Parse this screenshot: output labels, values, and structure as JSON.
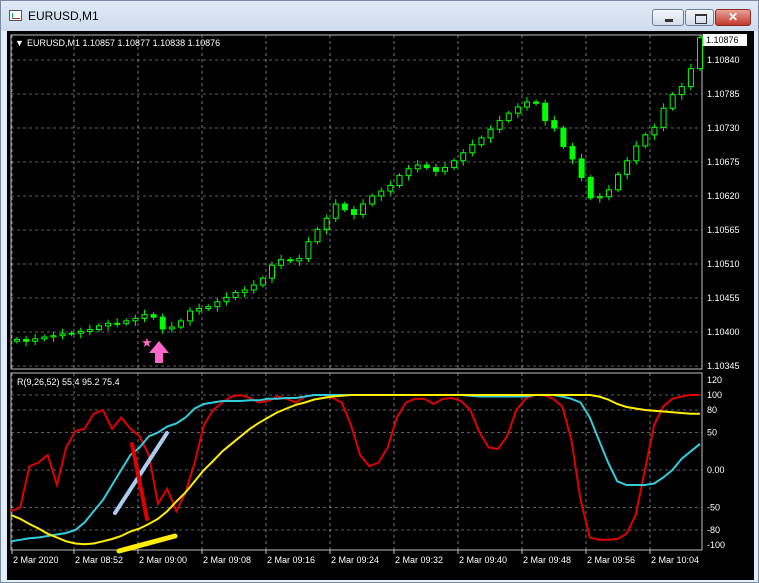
{
  "window": {
    "title": "EURUSD,M1"
  },
  "main_chart": {
    "info_line": "EURUSD,M1  1.10857 1.10877 1.10838 1.10876",
    "current_price": "1.10876",
    "price_axis": [
      "1.10840",
      "1.10785",
      "1.10730",
      "1.10675",
      "1.10620",
      "1.10565",
      "1.10510",
      "1.10455",
      "1.10400",
      "1.10345"
    ]
  },
  "indicator": {
    "label": "R(9,26,52) 55.4 95.2 75.4",
    "axis": [
      "120",
      "100",
      "80",
      "50",
      "0.00",
      "-50",
      "-80",
      "-100"
    ]
  },
  "time_axis": [
    "2 Mar 2020",
    "2 Mar 08:52",
    "2 Mar 09:00",
    "2 Mar 09:08",
    "2 Mar 09:16",
    "2 Mar 09:24",
    "2 Mar 09:32",
    "2 Mar 09:40",
    "2 Mar 09:48",
    "2 Mar 09:56",
    "2 Mar 10:04"
  ],
  "colors": {
    "background": "#000000",
    "candles": "#00ff00",
    "grid": "#c0c0c0",
    "fast_line": "#e00000",
    "mid_line": "#33ccdd",
    "slow_line": "#ffee00",
    "annotation_pink": "#ff66cc"
  },
  "chart_data": [
    {
      "type": "candlestick",
      "symbol": "EURUSD",
      "timeframe": "M1",
      "x_range": [
        "2 Mar 2020 08:44",
        "2 Mar 2020 10:10"
      ],
      "y_range": [
        1.10345,
        1.10876
      ],
      "last_ohlc": {
        "open": 1.10857,
        "high": 1.10877,
        "low": 1.10838,
        "close": 1.10876
      },
      "close": [
        1.10388,
        1.10385,
        1.10389,
        1.10392,
        1.10394,
        1.10397,
        1.10398,
        1.10401,
        1.10404,
        1.1041,
        1.10414,
        1.10414,
        1.10418,
        1.10422,
        1.10428,
        1.10424,
        1.10405,
        1.10408,
        1.10418,
        1.10434,
        1.10438,
        1.10441,
        1.10449,
        1.10456,
        1.10464,
        1.10468,
        1.10476,
        1.10487,
        1.10508,
        1.10517,
        1.10515,
        1.10519,
        1.10546,
        1.10566,
        1.10584,
        1.10607,
        1.10598,
        1.1059,
        1.10607,
        1.1062,
        1.10628,
        1.10637,
        1.10653,
        1.10664,
        1.1067,
        1.10666,
        1.1066,
        1.10666,
        1.10677,
        1.1069,
        1.10703,
        1.10714,
        1.10728,
        1.10742,
        1.10754,
        1.10764,
        1.10772,
        1.1077,
        1.10742,
        1.1073,
        1.107,
        1.1068,
        1.1065,
        1.10617,
        1.10619,
        1.1063,
        1.10655,
        1.10677,
        1.10701,
        1.10719,
        1.10731,
        1.10762,
        1.10784,
        1.10797,
        1.10826,
        1.10876
      ]
    },
    {
      "type": "line",
      "title": "R(9,26,52) 55.4 95.2 75.4",
      "ylim": [
        -100,
        120
      ],
      "series": [
        {
          "name": "R(9)",
          "color": "#e00000",
          "values": [
            -55,
            -50,
            5,
            10,
            20,
            -20,
            30,
            52,
            55,
            75,
            80,
            55,
            70,
            55,
            45,
            20,
            -45,
            -25,
            -55,
            -30,
            10,
            60,
            80,
            90,
            98,
            100,
            96,
            90,
            92,
            98,
            95,
            90,
            98,
            100,
            100,
            96,
            90,
            60,
            20,
            5,
            10,
            30,
            70,
            90,
            95,
            95,
            88,
            95,
            96,
            92,
            80,
            50,
            30,
            28,
            45,
            80,
            95,
            100,
            100,
            95,
            85,
            40,
            -40,
            -90,
            -93,
            -93,
            -92,
            -85,
            -60,
            0,
            60,
            85,
            95,
            98,
            100,
            100
          ]
        },
        {
          "name": "R(26)",
          "color": "#33ccdd",
          "values": [
            -95,
            -93,
            -91,
            -90,
            -88,
            -86,
            -84,
            -80,
            -70,
            -55,
            -40,
            -20,
            0,
            20,
            30,
            45,
            50,
            58,
            62,
            70,
            82,
            88,
            90,
            92,
            92,
            92,
            93,
            93,
            95,
            95,
            96,
            96,
            98,
            100,
            100,
            100,
            100,
            100,
            100,
            100,
            100,
            100,
            100,
            100,
            100,
            100,
            100,
            100,
            100,
            100,
            99,
            98,
            98,
            98,
            98,
            98,
            98,
            100,
            100,
            100,
            98,
            95,
            90,
            70,
            40,
            10,
            -15,
            -20,
            -20,
            -20,
            -18,
            -10,
            0,
            15,
            25,
            35
          ]
        },
        {
          "name": "R(52)",
          "color": "#ffee00",
          "values": [
            -60,
            -65,
            -72,
            -78,
            -85,
            -90,
            -95,
            -98,
            -99,
            -98,
            -95,
            -92,
            -88,
            -82,
            -78,
            -72,
            -65,
            -55,
            -42,
            -30,
            -15,
            0,
            12,
            25,
            35,
            45,
            55,
            63,
            70,
            77,
            82,
            87,
            90,
            94,
            96,
            98,
            99,
            100,
            100,
            100,
            100,
            100,
            100,
            100,
            100,
            100,
            100,
            100,
            100,
            100,
            100,
            100,
            100,
            100,
            100,
            100,
            100,
            100,
            100,
            100,
            100,
            100,
            100,
            100,
            98,
            94,
            88,
            84,
            82,
            80,
            79,
            78,
            77,
            76,
            75,
            75
          ]
        }
      ]
    }
  ]
}
